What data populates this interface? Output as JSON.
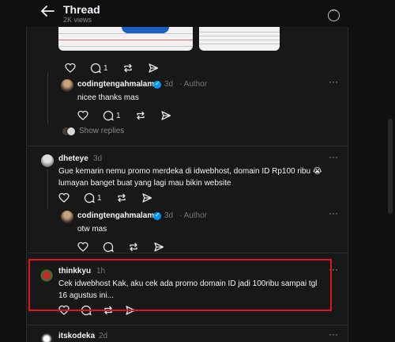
{
  "header": {
    "title": "Thread",
    "views": "2K views"
  },
  "posts": [
    {
      "id": "reply1",
      "name": "codingtengahmalam",
      "time": "3d",
      "role": "· Author",
      "text": "nicee thanks mas",
      "likes": "",
      "comments": "1"
    },
    {
      "id": "comment2",
      "name": "dheteye",
      "time": "3d",
      "text": "Gue kemarin nemu promo merdeka di idwebhost, domain ID Rp100 ribu 😭 lumayan banget buat yang lagi mau bikin website",
      "likes": "",
      "comments": "1"
    },
    {
      "id": "reply2",
      "name": "codingtengahmalam",
      "time": "3d",
      "role": "· Author",
      "text": "otw mas"
    },
    {
      "id": "comment3",
      "name": "thinkkyu",
      "time": "1h",
      "text": "Cek idwebhost Kak, aku cek ada promo domain ID jadi 100ribu sampai tgl 16 agustus ini..."
    },
    {
      "id": "comment4",
      "name": "itskodeka",
      "time": "2d"
    }
  ],
  "top_actions": {
    "comments": "1"
  },
  "show_replies": "Show replies",
  "colors": {
    "verified": "#0095f6",
    "highlight": "#e0141e",
    "background": "#101010"
  }
}
